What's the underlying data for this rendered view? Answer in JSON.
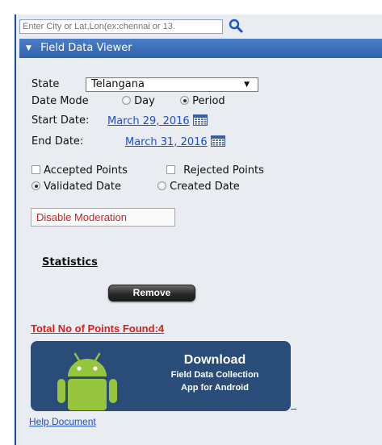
{
  "search": {
    "placeholder": "Enter City or Lat,Lon(ex:chennai or 13.",
    "icon": "search-icon"
  },
  "panel": {
    "title": "Field Data Viewer",
    "icon": "chevron-down-icon"
  },
  "filters": {
    "state_label": "State",
    "state_value": "Telangana",
    "date_mode_label": "Date Mode",
    "date_mode_options": [
      "Day",
      "Period"
    ],
    "date_mode_selected": "Period",
    "start_date_label": "Start Date:",
    "start_date_value": "March 29, 2016",
    "end_date_label": "End Date:",
    "end_date_value": "March 31, 2016",
    "calendar_icon": "calendar-icon"
  },
  "points": {
    "accepted_label": "Accepted Points",
    "rejected_label": "Rejected Points",
    "accepted_checked": false,
    "rejected_checked": false,
    "validated_label": "Validated Date",
    "created_label": "Created Date",
    "date_basis_selected": "Validated Date"
  },
  "actions": {
    "moderation_label": "Disable Moderation",
    "remove_label": "Remove"
  },
  "stats": {
    "label": "Statistics",
    "total_text": "Total No of Points Found:4"
  },
  "banner": {
    "title": "Download",
    "line1": "Field Data Collection",
    "line2": "App for Android",
    "background": "#2a4c78",
    "robot_color": "#97c63e"
  },
  "help": {
    "label": "Help Document"
  }
}
